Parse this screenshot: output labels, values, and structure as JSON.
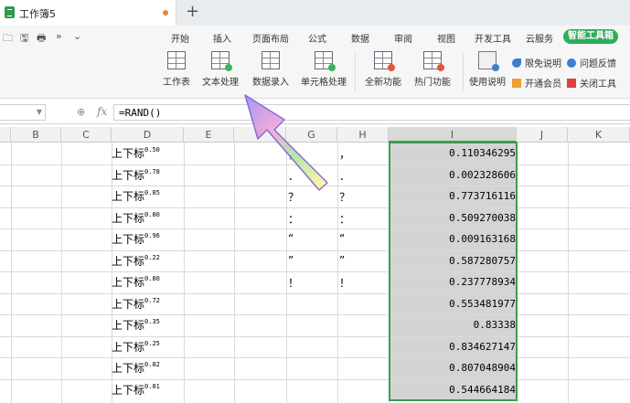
{
  "window": {
    "doc_tab_title": "工作簿5",
    "new_tab_symbol": "+"
  },
  "quick_access": [
    "🗀",
    "🖫",
    "🖶",
    "»",
    "⌄"
  ],
  "menu": {
    "items": [
      "开始",
      "插入",
      "页面布局",
      "公式",
      "数据",
      "审阅",
      "视图",
      "开发工具",
      "云服务"
    ],
    "active": "智能工具箱"
  },
  "ribbon": {
    "buttons": [
      {
        "label": "工作表",
        "icon": "worksheet-icon"
      },
      {
        "label": "文本处理",
        "icon": "text-process-icon"
      },
      {
        "label": "数据录入",
        "icon": "data-entry-icon"
      },
      {
        "label": "单元格处理",
        "icon": "cell-process-icon"
      },
      {
        "label": "全新功能",
        "icon": "new-feature-icon"
      },
      {
        "label": "热门功能",
        "icon": "hot-feature-icon"
      },
      {
        "label": "使用说明",
        "icon": "usage-info-icon"
      }
    ],
    "side": {
      "free_label": "限免说明",
      "feedback_label": "问题反馈",
      "member_label": "开通会员",
      "close_label": "关闭工具"
    }
  },
  "formula_bar": {
    "fx": "fx",
    "formula": "=RAND()"
  },
  "columns": [
    "B",
    "C",
    "D",
    "E",
    "F",
    "G",
    "H",
    "I",
    "J",
    "K"
  ],
  "rows": [
    {
      "d": "上下标",
      "sup": "0.50",
      "g": "，",
      "h": "，",
      "i": "0.110346295"
    },
    {
      "d": "上下标",
      "sup": "0.78",
      "g": "．",
      "h": "．",
      "i": "0.002328606"
    },
    {
      "d": "上下标",
      "sup": "0.85",
      "g": "？",
      "h": "？",
      "i": "0.773716116"
    },
    {
      "d": "上下标",
      "sup": "0.80",
      "g": "：",
      "h": "：",
      "i": "0.509270038"
    },
    {
      "d": "上下标",
      "sup": "0.96",
      "g": "“",
      "h": "“",
      "i": "0.009163168"
    },
    {
      "d": "上下标",
      "sup": "0.22",
      "g": "”",
      "h": "”",
      "i": "0.587280757"
    },
    {
      "d": "上下标",
      "sup": "0.80",
      "g": "！",
      "h": "！",
      "i": "0.237778934"
    },
    {
      "d": "上下标",
      "sup": "0.72",
      "g": "",
      "h": "",
      "i": "0.553481977"
    },
    {
      "d": "上下标",
      "sup": "0.35",
      "g": "",
      "h": "",
      "i": "0.83338"
    },
    {
      "d": "上下标",
      "sup": "0.25",
      "g": "",
      "h": "",
      "i": "0.834627147"
    },
    {
      "d": "上下标",
      "sup": "0.82",
      "g": "",
      "h": "",
      "i": "0.807048904"
    },
    {
      "d": "上下标",
      "sup": "0.81",
      "g": "",
      "h": "",
      "i": "0.544664184"
    }
  ],
  "colors": {
    "accent_green": "#2eac5a",
    "selection_border": "#3e9b4f",
    "selection_fill": "#d4d4d4"
  }
}
